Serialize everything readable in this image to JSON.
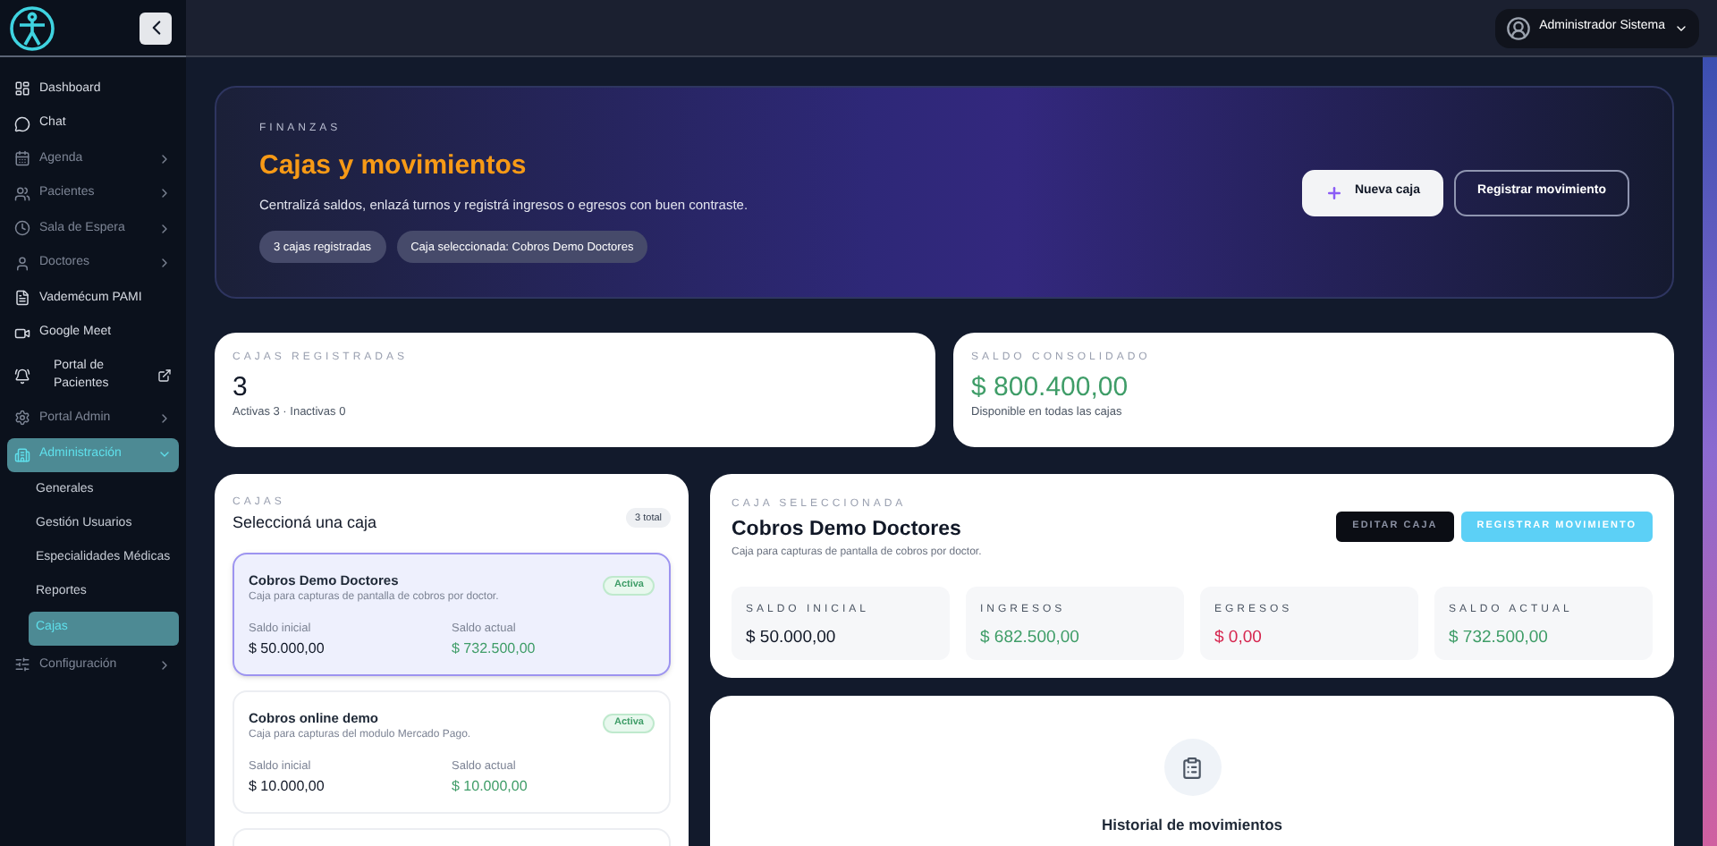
{
  "sidebar": {
    "items": [
      {
        "label": "Dashboard",
        "kind": "link",
        "selected": false
      },
      {
        "label": "Chat",
        "kind": "link",
        "selected": false
      },
      {
        "label": "Agenda",
        "kind": "group",
        "selected": false,
        "expanded": false
      },
      {
        "label": "Pacientes",
        "kind": "group",
        "selected": false,
        "expanded": false
      },
      {
        "label": "Sala de Espera",
        "kind": "group",
        "selected": false,
        "expanded": false
      },
      {
        "label": "Doctores",
        "kind": "group",
        "selected": false,
        "expanded": false
      },
      {
        "label": "Vademécum PAMI",
        "kind": "link",
        "selected": false
      },
      {
        "label": "Google Meet",
        "kind": "link",
        "selected": false
      },
      {
        "label": "Portal de Pacientes",
        "kind": "external",
        "selected": false
      },
      {
        "label": "Portal Admin",
        "kind": "group",
        "selected": false,
        "expanded": false
      },
      {
        "label": "Administración",
        "kind": "group",
        "selected": true,
        "expanded": true,
        "children": [
          {
            "label": "Generales",
            "selected": false
          },
          {
            "label": "Gestión Usuarios",
            "selected": false
          },
          {
            "label": "Especialidades Médicas",
            "selected": false
          },
          {
            "label": "Reportes",
            "selected": false
          },
          {
            "label": "Cajas",
            "selected": true
          }
        ]
      },
      {
        "label": "Configuración",
        "kind": "group",
        "selected": false,
        "expanded": false
      }
    ]
  },
  "user_menu": {
    "name": "Administrador Sistema"
  },
  "hero": {
    "eyebrow": "FINANZAS",
    "title": "Cajas y movimientos",
    "subtitle": "Centralizá saldos, enlazá turnos y registrá ingresos o egresos con buen contraste.",
    "chips": [
      "3 cajas registradas",
      "Caja seleccionada: Cobros Demo Doctores"
    ],
    "buttons": [
      {
        "label": "Nueva caja",
        "kind": "primary"
      },
      {
        "label": "Registrar movimiento",
        "kind": "outline"
      }
    ]
  },
  "stats": [
    {
      "label": "CAJAS REGISTRADAS",
      "value": "3",
      "note": "Activas 3 · Inactivas 0",
      "color": "#111827"
    },
    {
      "label": "SALDO CONSOLIDADO",
      "value": "$ 800.400,00",
      "note": "Disponible en todas las cajas",
      "color": "#3f9d68"
    }
  ],
  "cajas_list": {
    "eyebrow": "CAJAS",
    "title": "Seleccioná una caja",
    "count": "3 total",
    "items": [
      {
        "name": "Cobros Demo Doctores",
        "description": "Caja para capturas de pantalla de cobros por doctor.",
        "status": "Activa",
        "selected": true,
        "initial_label": "Saldo inicial",
        "initial": "$ 50.000,00",
        "current_label": "Saldo actual",
        "current": "$ 732.500,00"
      },
      {
        "name": "Cobros online demo",
        "description": "Caja para capturas del modulo Mercado Pago.",
        "status": "Activa",
        "selected": false,
        "initial_label": "Saldo inicial",
        "initial": "$ 10.000,00",
        "current_label": "Saldo actual",
        "current": "$ 10.000,00"
      }
    ]
  },
  "selected_caja": {
    "eyebrow": "CAJA SELECCIONADA",
    "title": "Cobros Demo Doctores",
    "description": "Caja para capturas de pantalla de cobros por doctor.",
    "buttons": [
      {
        "label": "EDITAR CAJA",
        "kind": "dark"
      },
      {
        "label": "REGISTRAR MOVIMIENTO",
        "kind": "accent"
      }
    ],
    "metrics": [
      {
        "label": "SALDO INICIAL",
        "value": "$ 50.000,00",
        "color": "#111827"
      },
      {
        "label": "INGRESOS",
        "value": "$ 682.500,00",
        "color": "#3f9d68"
      },
      {
        "label": "EGRESOS",
        "value": "$ 0,00",
        "color": "#d6264f"
      },
      {
        "label": "SALDO ACTUAL",
        "value": "$ 732.500,00",
        "color": "#3f9d68"
      }
    ]
  },
  "history": {
    "title": "Historial de movimientos"
  }
}
